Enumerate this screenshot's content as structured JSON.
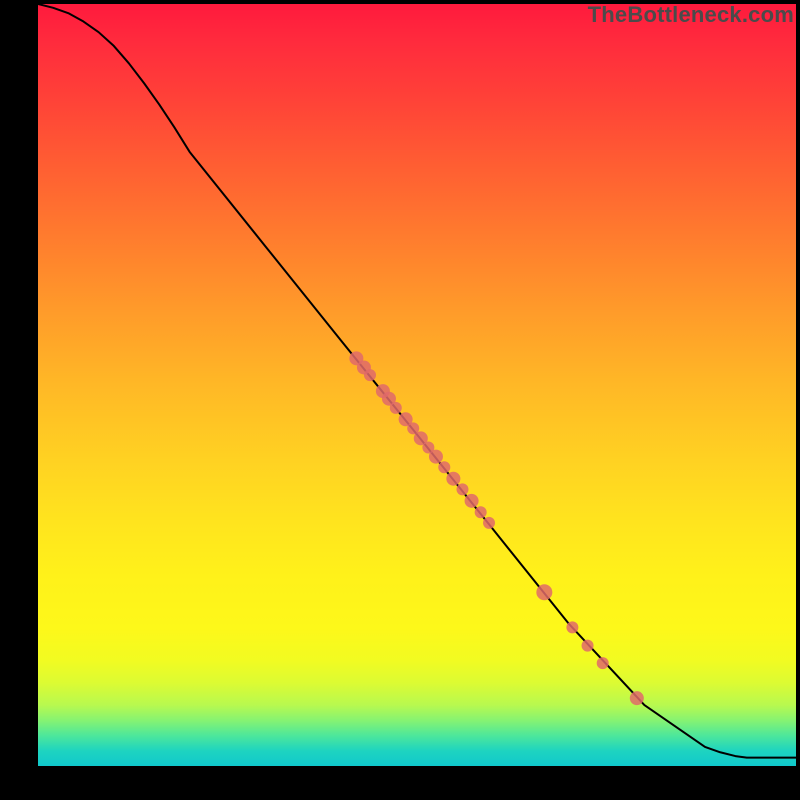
{
  "watermark": "TheBottleneck.com",
  "colors": {
    "line": "#000000",
    "marker_fill": "#e06a6a",
    "marker_stroke": "#c84f4f",
    "gradient_top": "#ff1a3d",
    "gradient_bottom": "#10c8cc"
  },
  "chart_data": {
    "type": "line",
    "title": "",
    "xlabel": "",
    "ylabel": "",
    "xlim": [
      0,
      100
    ],
    "ylim": [
      0,
      100
    ],
    "grid": false,
    "legend": false,
    "series": [
      {
        "name": "curve",
        "kind": "line",
        "x": [
          0.0,
          2.0,
          4.0,
          6.0,
          8.0,
          10.0,
          12.0,
          14.0,
          16.0,
          18.0,
          20.0,
          30.0,
          40.0,
          50.0,
          60.0,
          70.0,
          80.0,
          88.0,
          90.0,
          92.0,
          93.5,
          100.0
        ],
        "y": [
          100.0,
          99.5,
          98.8,
          97.7,
          96.3,
          94.5,
          92.2,
          89.6,
          86.8,
          83.8,
          80.6,
          68.2,
          55.8,
          43.5,
          31.1,
          18.7,
          8.0,
          2.5,
          1.8,
          1.3,
          1.1,
          1.1
        ]
      },
      {
        "name": "markers",
        "kind": "scatter",
        "points": [
          {
            "x": 42.0,
            "y": 53.5,
            "r": 7
          },
          {
            "x": 43.0,
            "y": 52.3,
            "r": 7
          },
          {
            "x": 43.8,
            "y": 51.3,
            "r": 6
          },
          {
            "x": 45.5,
            "y": 49.2,
            "r": 7
          },
          {
            "x": 46.3,
            "y": 48.2,
            "r": 7
          },
          {
            "x": 47.2,
            "y": 47.0,
            "r": 6
          },
          {
            "x": 48.5,
            "y": 45.5,
            "r": 7
          },
          {
            "x": 49.5,
            "y": 44.3,
            "r": 6
          },
          {
            "x": 50.5,
            "y": 43.0,
            "r": 7
          },
          {
            "x": 51.5,
            "y": 41.8,
            "r": 6
          },
          {
            "x": 52.5,
            "y": 40.6,
            "r": 7
          },
          {
            "x": 53.6,
            "y": 39.2,
            "r": 6
          },
          {
            "x": 54.8,
            "y": 37.7,
            "r": 7
          },
          {
            "x": 56.0,
            "y": 36.3,
            "r": 6
          },
          {
            "x": 57.2,
            "y": 34.8,
            "r": 7
          },
          {
            "x": 58.4,
            "y": 33.3,
            "r": 6
          },
          {
            "x": 59.5,
            "y": 31.9,
            "r": 6
          },
          {
            "x": 66.8,
            "y": 22.8,
            "r": 8
          },
          {
            "x": 70.5,
            "y": 18.2,
            "r": 6
          },
          {
            "x": 72.5,
            "y": 15.8,
            "r": 6
          },
          {
            "x": 74.5,
            "y": 13.5,
            "r": 6
          },
          {
            "x": 79.0,
            "y": 8.9,
            "r": 7
          }
        ]
      }
    ]
  }
}
